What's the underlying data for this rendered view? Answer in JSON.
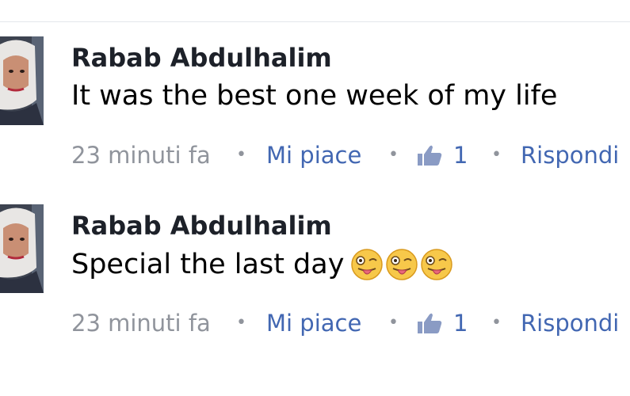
{
  "comments": [
    {
      "author": "Rabab Abdulhalim",
      "text": "It was the best one week of my life",
      "emojis": [],
      "time": "23 minuti fa",
      "like_label": "Mi piace",
      "like_count": "1",
      "reply_label": "Rispondi",
      "separator": "•"
    },
    {
      "author": "Rabab Abdulhalim",
      "text": "Special the last day",
      "emojis": [
        "winking-tongue-out-emoji",
        "winking-tongue-out-emoji",
        "winking-tongue-out-emoji"
      ],
      "time": "23 minuti fa",
      "like_label": "Mi piace",
      "like_count": "1",
      "reply_label": "Rispondi",
      "separator": "•"
    }
  ],
  "colors": {
    "author": "#1d2129",
    "meta_gray": "#90949c",
    "link_blue": "#4267b2",
    "thumb_icon": "#8a9bc4"
  },
  "icons": {
    "like": "thumbs-up-icon"
  }
}
